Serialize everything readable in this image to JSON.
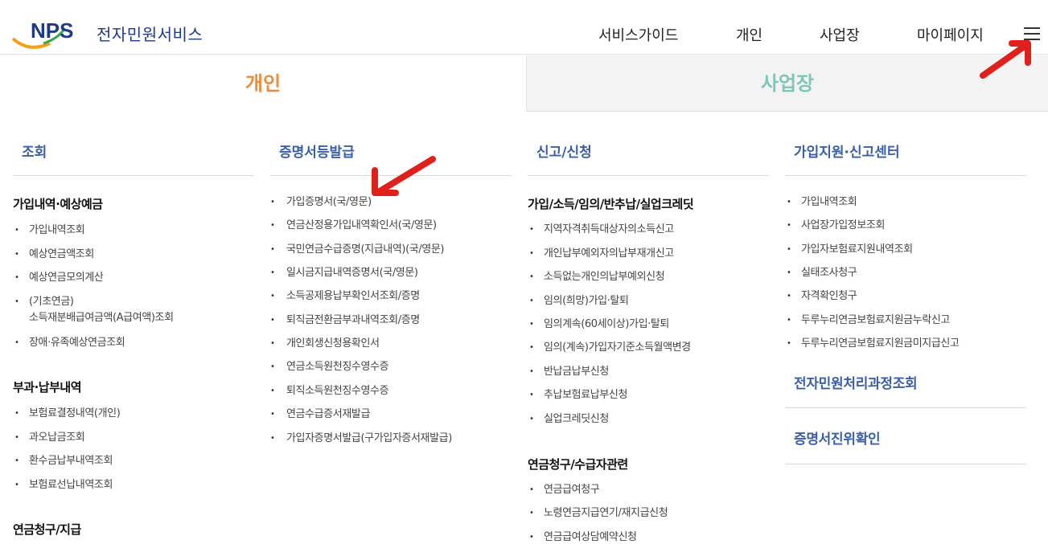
{
  "header": {
    "logo_text": "NPS",
    "service_name": "전자민원서비스",
    "nav": [
      "서비스가이드",
      "개인",
      "사업장",
      "마이페이지"
    ],
    "menu_icon": "hamburger-menu-icon"
  },
  "tabs": {
    "personal": "개인",
    "business": "사업장"
  },
  "columns": {
    "c1": {
      "title": "조회",
      "sections": [
        {
          "title": "가입내역·예상예금",
          "items": [
            "가입내역조회",
            "예상연금액조회",
            "예상연금모의계산",
            "(기초연금)",
            "소득재분배급여금액(A급여액)조회",
            "장애·유족예상연금조회"
          ]
        },
        {
          "title": "부과·납부내역",
          "items": [
            "보험료결정내역(개인)",
            "과오납금조회",
            "환수금납부내역조회",
            "보험료선납내역조회"
          ]
        },
        {
          "title": "연금청구/지급",
          "items": []
        }
      ]
    },
    "c2": {
      "title": "증명서등발급",
      "items": [
        "가입증명서(국/영문)",
        "연금산정용가입내역확인서(국/영문)",
        "국민연금수급증명(지급내역)(국/영문)",
        "일시금지급내역증명서(국/영문)",
        "소득공제용납부확인서조회/증명",
        "퇴직금전환금부과내역조회/증명",
        "개인회생신청용확인서",
        "연금소득원천징수영수증",
        "퇴직소득원천징수영수증",
        "연금수급증서재발급",
        "가입자증명서발급(구가입자증서재발급)"
      ]
    },
    "c3": {
      "title": "신고/신청",
      "sections": [
        {
          "title": "가입/소득/임의/반추납/실업크레딧",
          "items": [
            "지역자격취득대상자의소득신고",
            "개인납부예외자의납부재개신고",
            "소득없는개인의납부예외신청",
            "임의(희망)가입·탈퇴",
            "임의계속(60세이상)가입·탈퇴",
            "임의(계속)가입자기준소득월액변경",
            "반납금납부신청",
            "추납보험료납부신청",
            "실업크레딧신청"
          ]
        },
        {
          "title": "연금청구/수급자관련",
          "items": [
            "연금급여청구",
            "노령연금지급연기/재지급신청",
            "연금급여상담예약신청"
          ]
        }
      ]
    },
    "c4": {
      "title": "가입지원·신고센터",
      "items": [
        "가입내역조회",
        "사업장가입정보조회",
        "가입자보험료지원내역조회",
        "실태조사청구",
        "자격확인청구",
        "두루누리연금보험료지원금누락신고",
        "두루누리연금보험료지원금미지급신고"
      ],
      "blocks": [
        "전자민원처리과정조회",
        "증명서진위확인"
      ]
    }
  },
  "colors": {
    "brand_blue": "#1d3a8a",
    "section_blue": "#3a5fa8",
    "personal_orange": "#ee8a3c",
    "business_teal": "#7ec6b5",
    "annotation_red": "#e0201b"
  },
  "annotations": [
    "red-arrow-icon",
    "red-arrow-icon"
  ]
}
